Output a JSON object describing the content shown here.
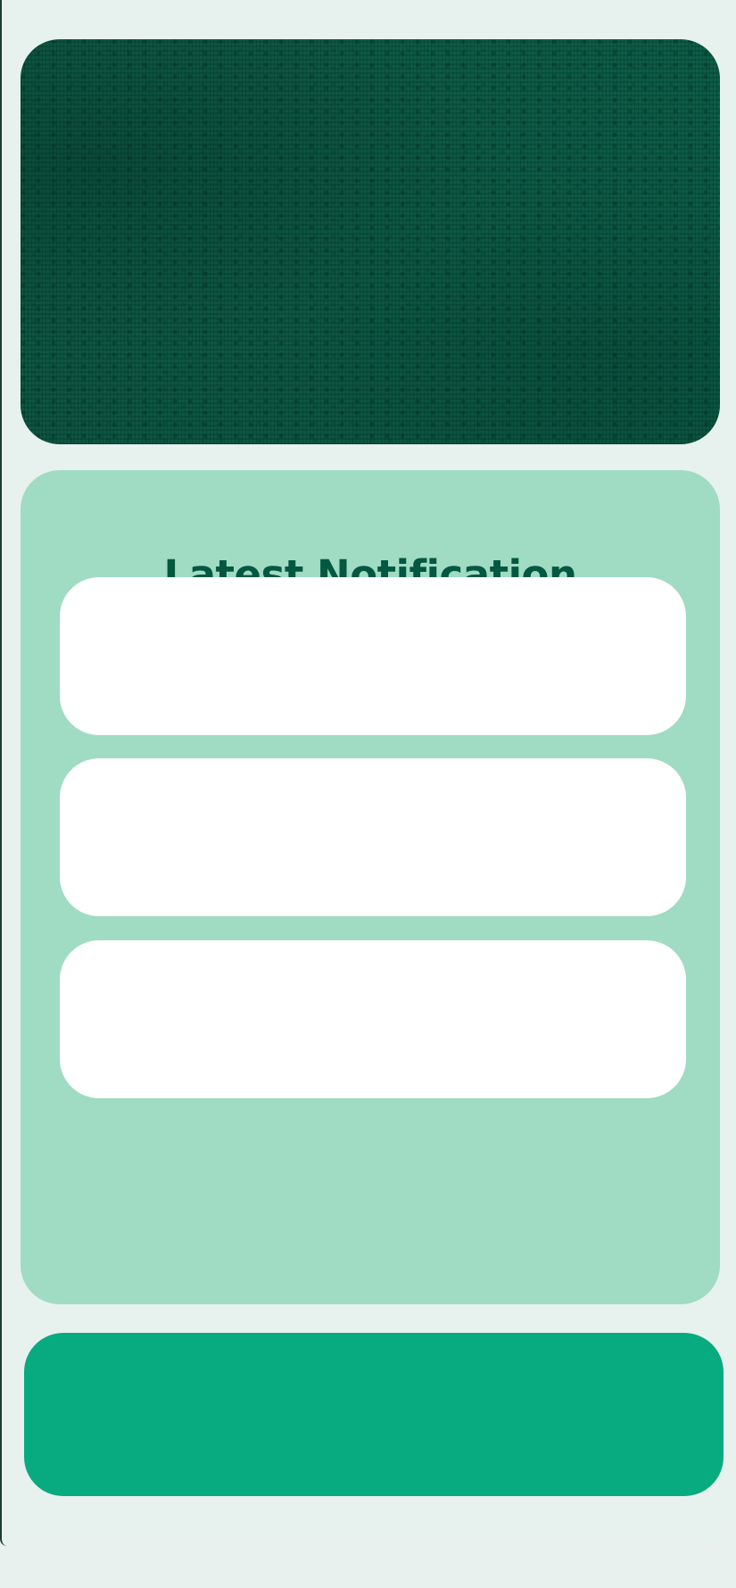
{
  "notifications": {
    "title": "Latest Notification",
    "items": [
      {},
      {},
      {}
    ]
  },
  "colors": {
    "background": "#e8f1ee",
    "hero": "#04563f",
    "panel": "#a0dbc4",
    "title": "#045740",
    "action": "#08aa80"
  }
}
